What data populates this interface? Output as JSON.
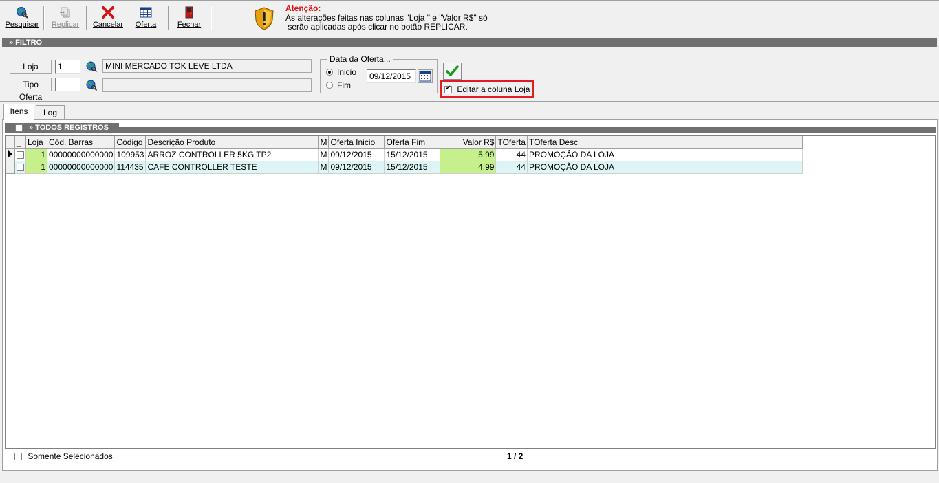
{
  "toolbar": {
    "buttons": [
      {
        "label": "Pesquisar",
        "icon": "globe-search-icon",
        "enabled": true
      },
      {
        "label": "Replicar",
        "icon": "replicate-icon",
        "enabled": false
      },
      {
        "label": "Cancelar",
        "icon": "red-x-icon",
        "enabled": true
      },
      {
        "label": "Oferta",
        "icon": "table-icon",
        "enabled": true
      },
      {
        "label": "Fechar",
        "icon": "exit-door-icon",
        "enabled": true
      }
    ],
    "warning_title": "Atenção:",
    "warning_line1": "As alterações feitas nas colunas \"Loja \" e \"Valor R$\" só",
    "warning_line2": " serão aplicadas após clicar no botão REPLICAR."
  },
  "filter": {
    "section_title": "» FILTRO",
    "loja_label": "Loja",
    "loja_value": "1",
    "loja_name": "MINI MERCADO TOK LEVE LTDA",
    "tipo_oferta_label": "Tipo Oferta",
    "tipo_oferta_value": "",
    "tipo_oferta_name": "",
    "date_group_title": "Data da Oferta...",
    "radio_inicio": "Inicio",
    "radio_fim": "Fim",
    "date_value": "09/12/2015",
    "edit_loja_checkbox": "Editar a coluna Loja"
  },
  "tabs": [
    "Itens",
    "Log"
  ],
  "grid": {
    "section_title": "» TODOS REGISTROS",
    "columns": [
      "_",
      "Loja",
      "Cód. Barras",
      "Código",
      "Descrição Produto",
      "M",
      "Oferta Inicio",
      "Oferta Fim",
      "Valor R$",
      "TOferta",
      "TOferta Desc"
    ],
    "rows": [
      {
        "loja": "1",
        "barras": "00000000000000",
        "codigo": "109953",
        "descricao": "ARROZ CONTROLLER 5KG TP2",
        "m": "M",
        "inicio": "09/12/2015",
        "fim": "15/12/2015",
        "valor": "5,99",
        "toferta": "44",
        "toferta_desc": "PROMOÇÃO DA LOJA"
      },
      {
        "loja": "1",
        "barras": "00000000000000",
        "codigo": "114435",
        "descricao": "CAFE CONTROLLER TESTE",
        "m": "M",
        "inicio": "09/12/2015",
        "fim": "15/12/2015",
        "valor": "4,99",
        "toferta": "44",
        "toferta_desc": "PROMOÇÃO DA LOJA"
      }
    ]
  },
  "footer": {
    "somente_selecionados": "Somente Selecionados",
    "pager": "1 / 2"
  },
  "colors": {
    "highlight": "#e01c24",
    "green_cell": "#c6f08c",
    "alt_row": "#ddf5f5",
    "warning": "#e01010"
  }
}
